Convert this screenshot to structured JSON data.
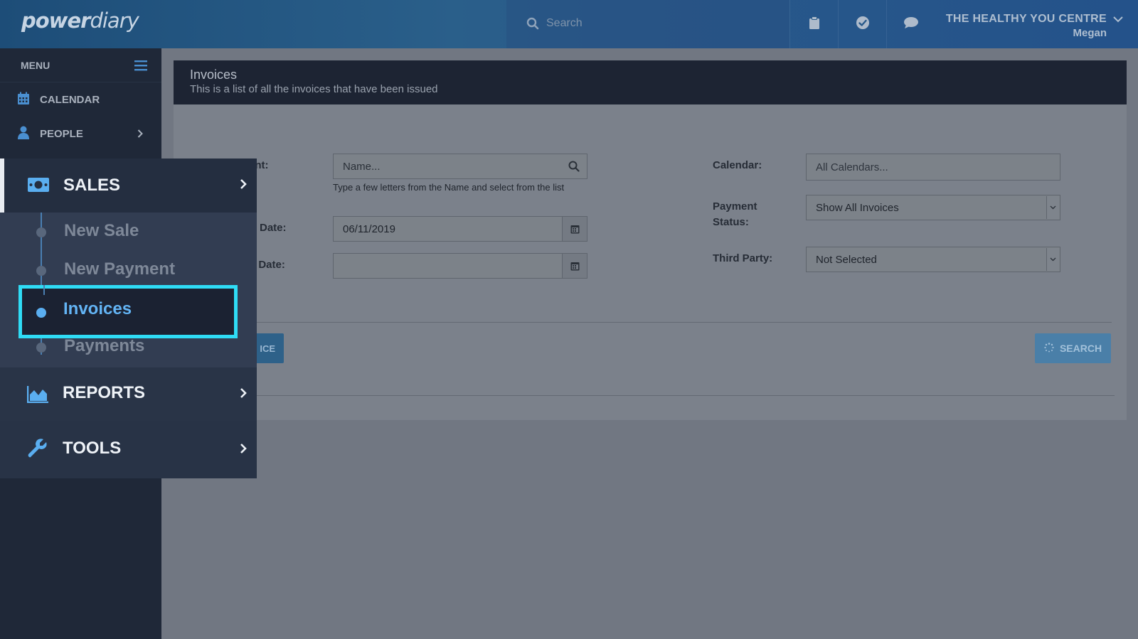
{
  "app": {
    "logo_bold": "power",
    "logo_light": "diary"
  },
  "topbar": {
    "search_placeholder": "Search",
    "clinic_name": "THE HEALTHY YOU CENTRE",
    "user_name": "Megan",
    "icons": [
      "clipboard-icon",
      "check-circle-icon",
      "chat-bubble-icon",
      "chevron-down-icon"
    ]
  },
  "sidebar": {
    "menu_label": "MENU",
    "items": [
      {
        "label": "CALENDAR",
        "icon": "calendar-icon"
      },
      {
        "label": "PEOPLE",
        "icon": "person-icon"
      }
    ]
  },
  "page": {
    "title": "Invoices",
    "subtitle": "This is a list of all the invoices that have been issued"
  },
  "form": {
    "client_label": "ent:",
    "client_placeholder": "Name...",
    "client_hint": "Type a few letters from the Name and select from the list",
    "start_date_label": "rt Date:",
    "start_date_value": "06/11/2019",
    "end_date_label": "d Date:",
    "end_date_value": "",
    "calendar_label": "Calendar:",
    "calendar_placeholder": "All Calendars...",
    "payment_status_label_1": "Payment",
    "payment_status_label_2": "Status:",
    "payment_status_value": "Show All Invoices",
    "third_party_label": "Third Party:",
    "third_party_value": "Not Selected",
    "invoice_button": "ICE",
    "search_button": "SEARCH"
  },
  "flyout": {
    "sales_label": "SALES",
    "sub_items": [
      {
        "label": "New Sale",
        "active": false
      },
      {
        "label": "New Payment",
        "active": false
      },
      {
        "label": "Invoices",
        "active": true
      },
      {
        "label": "Payments",
        "active": false
      }
    ],
    "reports_label": "REPORTS",
    "tools_label": "TOOLS"
  },
  "colors": {
    "highlight": "#2fdcf5",
    "active_text": "#63b4f4",
    "sidebar_bg": "#1f2838"
  }
}
